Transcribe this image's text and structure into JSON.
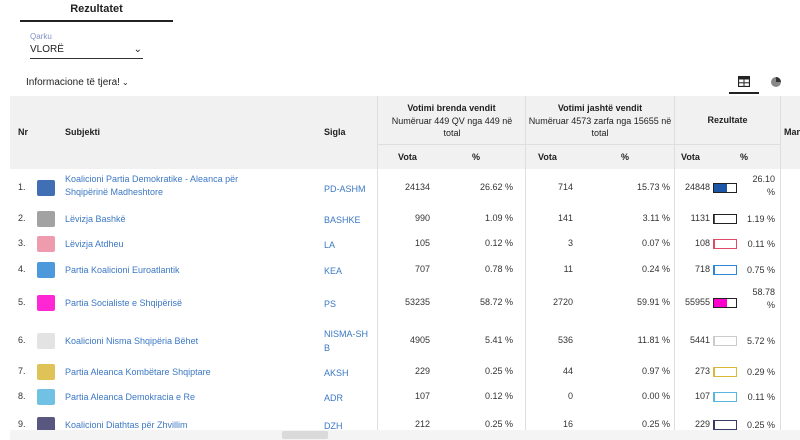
{
  "tabs": {
    "active": "Rezultatet"
  },
  "filter": {
    "label": "Qarku",
    "value": "VLORË"
  },
  "info_toggle": "Informacione të tjera!",
  "table": {
    "headers": {
      "nr": "Nr",
      "subject": "Subjekti",
      "acronym": "Sigla",
      "domestic_title": "Votimi brenda vendit",
      "domestic_sub": "Numëruar 449 QV nga 449 në total",
      "abroad_title": "Votimi jashtë vendit",
      "abroad_sub": "Numëruar 4573 zarfa nga 15655 në total",
      "results": "Rezultate",
      "truncated": "Man",
      "votes": "Vota",
      "percent": "%"
    },
    "rows": [
      {
        "nr": "1.",
        "name": "Koalicioni Partia Demokratike - Aleanca për Shqipërinë Madheshtore",
        "acr": "PD-ASHM",
        "dv": "24134",
        "dp": "26.62 %",
        "av": "714",
        "ap": "15.73 %",
        "tv": "24848",
        "tp": "26.10 %",
        "share": 0.6,
        "color": "#1e56a8",
        "logo": "pd-logo"
      },
      {
        "nr": "2.",
        "name": "Lëvizja Bashkë",
        "acr": "BASHKE",
        "dv": "990",
        "dp": "1.09 %",
        "av": "141",
        "ap": "3.11 %",
        "tv": "1131",
        "tp": "1.19 %",
        "share": 0.03,
        "color": "#555555",
        "logo": "bashke-logo"
      },
      {
        "nr": "3.",
        "name": "Lëvizja Atdheu",
        "acr": "LA",
        "dv": "105",
        "dp": "0.12 %",
        "av": "3",
        "ap": "0.07 %",
        "tv": "108",
        "tp": "0.11 %",
        "share": 0.01,
        "color": "#e04a6a",
        "logo": "atdheu-logo"
      },
      {
        "nr": "4.",
        "name": "Partia Koalicioni Euroatlantik",
        "acr": "KEA",
        "dv": "707",
        "dp": "0.78 %",
        "av": "11",
        "ap": "0.24 %",
        "tv": "718",
        "tp": "0.75 %",
        "share": 0.02,
        "color": "#2f86d6",
        "logo": "kea-logo"
      },
      {
        "nr": "5.",
        "name": "Partia Socialiste e Shqipërisë",
        "acr": "PS",
        "dv": "53235",
        "dp": "58.72 %",
        "av": "2720",
        "ap": "59.91 %",
        "tv": "55955",
        "tp": "58.78 %",
        "share": 0.6,
        "color": "#ff00cc",
        "logo": "ps-logo"
      },
      {
        "nr": "6.",
        "name": "Koalicioni Nisma Shqipëria Bëhet",
        "acr": "NISMA-SHB",
        "dv": "4905",
        "dp": "5.41 %",
        "av": "536",
        "ap": "11.81 %",
        "tv": "5441",
        "tp": "5.72 %",
        "share": 0.05,
        "color": "#cccccc",
        "logo": "nisma-logo"
      },
      {
        "nr": "7.",
        "name": "Partia Aleanca Kombëtare Shqiptare",
        "acr": "AKSH",
        "dv": "229",
        "dp": "0.25 %",
        "av": "44",
        "ap": "0.97 %",
        "tv": "273",
        "tp": "0.29 %",
        "share": 0.01,
        "color": "#d9b93a",
        "logo": "aksh-logo"
      },
      {
        "nr": "8.",
        "name": "Partia Aleanca Demokracia e Re",
        "acr": "ADR",
        "dv": "107",
        "dp": "0.12 %",
        "av": "0",
        "ap": "0.00 %",
        "tv": "107",
        "tp": "0.11 %",
        "share": 0.01,
        "color": "#58b6e0",
        "logo": "adr-logo"
      },
      {
        "nr": "9.",
        "name": "Koalicioni Diathtas për Zhvillim",
        "acr": "DZH",
        "dv": "212",
        "dp": "0.25 %",
        "av": "16",
        "ap": "0.25 %",
        "tv": "229",
        "tp": "0.25 %",
        "share": 0.01,
        "color": "#3a3a6a",
        "logo": "dzh-logo"
      }
    ]
  }
}
